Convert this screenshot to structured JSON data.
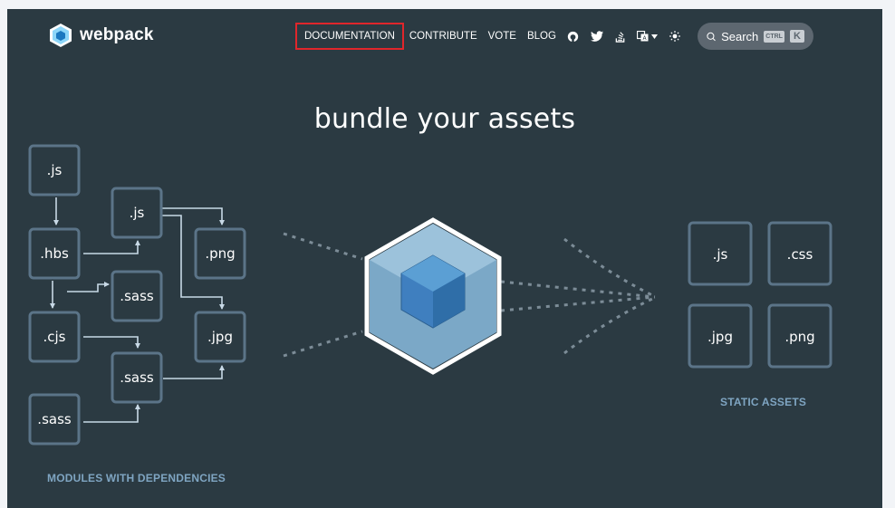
{
  "brand": {
    "name": "webpack"
  },
  "nav": {
    "links": [
      "DOCUMENTATION",
      "CONTRIBUTE",
      "VOTE",
      "BLOG"
    ],
    "icons": [
      "github-icon",
      "twitter-icon",
      "stackoverflow-icon",
      "language-icon",
      "theme-toggle-icon"
    ],
    "search": {
      "label": "Search",
      "kbd_ctrl": "CTRL",
      "kbd_k": "K"
    }
  },
  "hero": {
    "title": "bundle your assets"
  },
  "modules": {
    "boxes": [
      ".js",
      ".hbs",
      ".cjs",
      ".sass",
      ".js",
      ".sass",
      ".png",
      ".jpg",
      ".sass"
    ],
    "caption": "MODULES WITH DEPENDENCIES"
  },
  "assets": {
    "boxes": [
      ".js",
      ".css",
      ".jpg",
      ".png"
    ],
    "caption": "STATIC ASSETS"
  },
  "colors": {
    "background": "#2b3a42",
    "accent": "#8dd6f9",
    "active_outline": "#e0262b",
    "caption": "#7fa5c2"
  }
}
